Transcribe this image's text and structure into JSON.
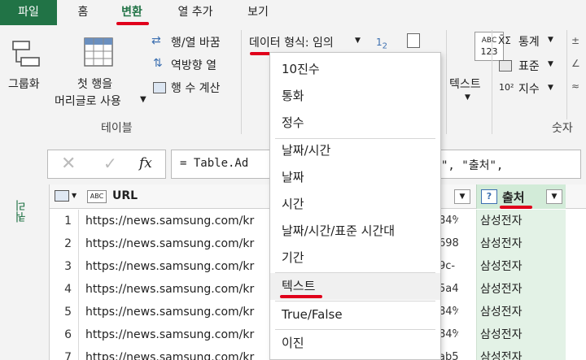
{
  "tabs": {
    "file": "파일",
    "home": "홈",
    "transform": "변환",
    "add_column": "열 추가",
    "view": "보기"
  },
  "ribbon": {
    "group_by": "그룹화",
    "first_row_line1": "첫 행을",
    "first_row_line2": "머리글로 사용",
    "transpose": "행/열 바꿈",
    "reverse_rows": "역방향 열",
    "count_rows": "행 수 계산",
    "table_group_label": "테이블",
    "data_type": "데이터 형식: 임의",
    "text_button": "텍스트",
    "statistics": "통계",
    "standard": "표준",
    "exponent": "지수",
    "number_group_label": "숫자",
    "abc_icon_line1": "ABC",
    "abc_icon_line2": "123"
  },
  "formula": {
    "fx": "fx",
    "text_left": "= Table.Ad",
    "text_right": "\", \"출처\","
  },
  "queries_pane": {
    "label": "쿼리"
  },
  "grid": {
    "col_url": "URL",
    "col_source": "출처",
    "rows": [
      {
        "n": "1",
        "url": "https://news.samsung.com/kr",
        "mid": "84%",
        "src": "삼성전자"
      },
      {
        "n": "2",
        "url": "https://news.samsung.com/kr",
        "mid": "698",
        "src": "삼성전자"
      },
      {
        "n": "3",
        "url": "https://news.samsung.com/kr",
        "mid": "9c-",
        "src": "삼성전자"
      },
      {
        "n": "4",
        "url": "https://news.samsung.com/kr",
        "mid": "5a4",
        "src": "삼성전자"
      },
      {
        "n": "5",
        "url": "https://news.samsung.com/kr",
        "mid": "84%",
        "src": "삼성전자"
      },
      {
        "n": "6",
        "url": "https://news.samsung.com/kr",
        "mid": "84%",
        "src": "삼성전자"
      },
      {
        "n": "7",
        "url": "https://news.samsung.com/kr",
        "mid": "ab5-",
        "src": "삼성전자"
      }
    ]
  },
  "menu": {
    "items": [
      "10진수",
      "통화",
      "정수",
      "날짜/시간",
      "날짜",
      "시간",
      "날짜/시간/표준 시간대",
      "기간",
      "텍스트",
      "True/False",
      "이진"
    ]
  },
  "colors": {
    "excel_green": "#217346",
    "highlight_red": "#e0001b",
    "source_col_bg": "#e3f2e6"
  }
}
